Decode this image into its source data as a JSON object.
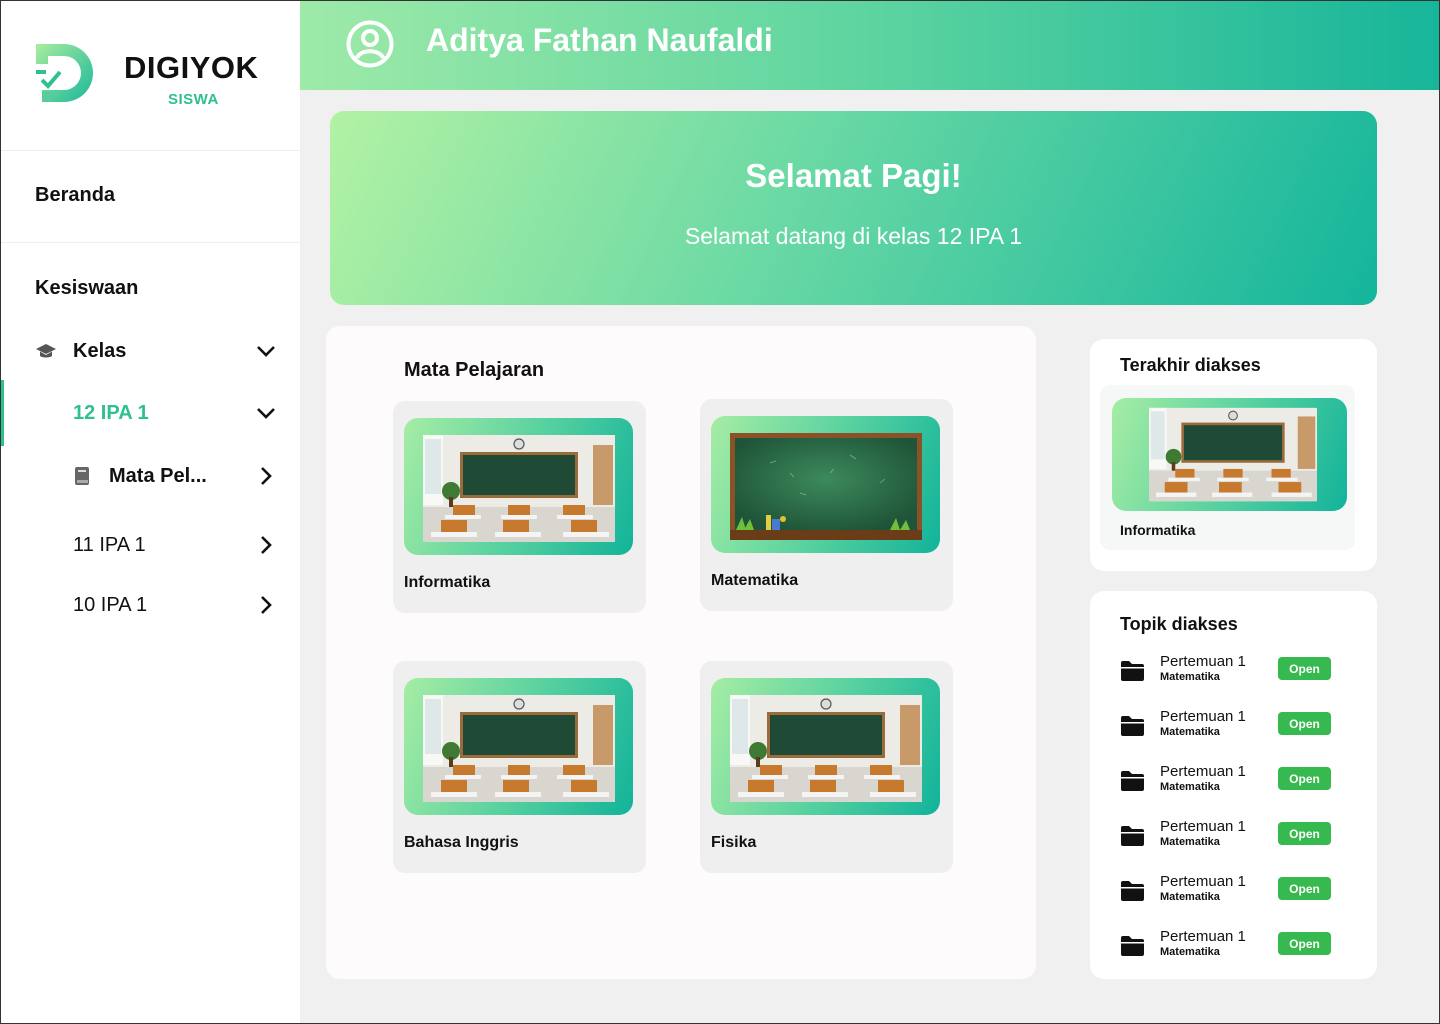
{
  "brand": {
    "name": "DIGIYOK",
    "sub": "SISWA",
    "accent": "#2fc08f"
  },
  "sidebar": {
    "beranda": "Beranda",
    "section": "Kesiswaan",
    "kelas": "Kelas",
    "class_active": "12 IPA 1",
    "mata_pelajaran": "Mata Pel...",
    "class_2": "11 IPA 1",
    "class_3": "10 IPA 1"
  },
  "header": {
    "user_name": "Aditya Fathan Naufaldi"
  },
  "hero": {
    "title": "Selamat Pagi!",
    "subtitle": "Selamat datang di kelas 12 IPA 1"
  },
  "subjects": {
    "title": "Mata Pelajaran",
    "items": [
      {
        "name": "Informatika",
        "image": "classroom"
      },
      {
        "name": "Matematika",
        "image": "chalkboard"
      },
      {
        "name": "Bahasa Inggris",
        "image": "classroom"
      },
      {
        "name": "Fisika",
        "image": "classroom"
      }
    ]
  },
  "recent": {
    "title": "Terakhir diakses",
    "item": "Informatika"
  },
  "topics": {
    "title": "Topik diakses",
    "items": [
      {
        "title": "Pertemuan 1",
        "subject": "Matematika",
        "action": "Open"
      },
      {
        "title": "Pertemuan 1",
        "subject": "Matematika",
        "action": "Open"
      },
      {
        "title": "Pertemuan 1",
        "subject": "Matematika",
        "action": "Open"
      },
      {
        "title": "Pertemuan 1",
        "subject": "Matematika",
        "action": "Open"
      },
      {
        "title": "Pertemuan 1",
        "subject": "Matematika",
        "action": "Open"
      },
      {
        "title": "Pertemuan 1",
        "subject": "Matematika",
        "action": "Open"
      }
    ]
  }
}
